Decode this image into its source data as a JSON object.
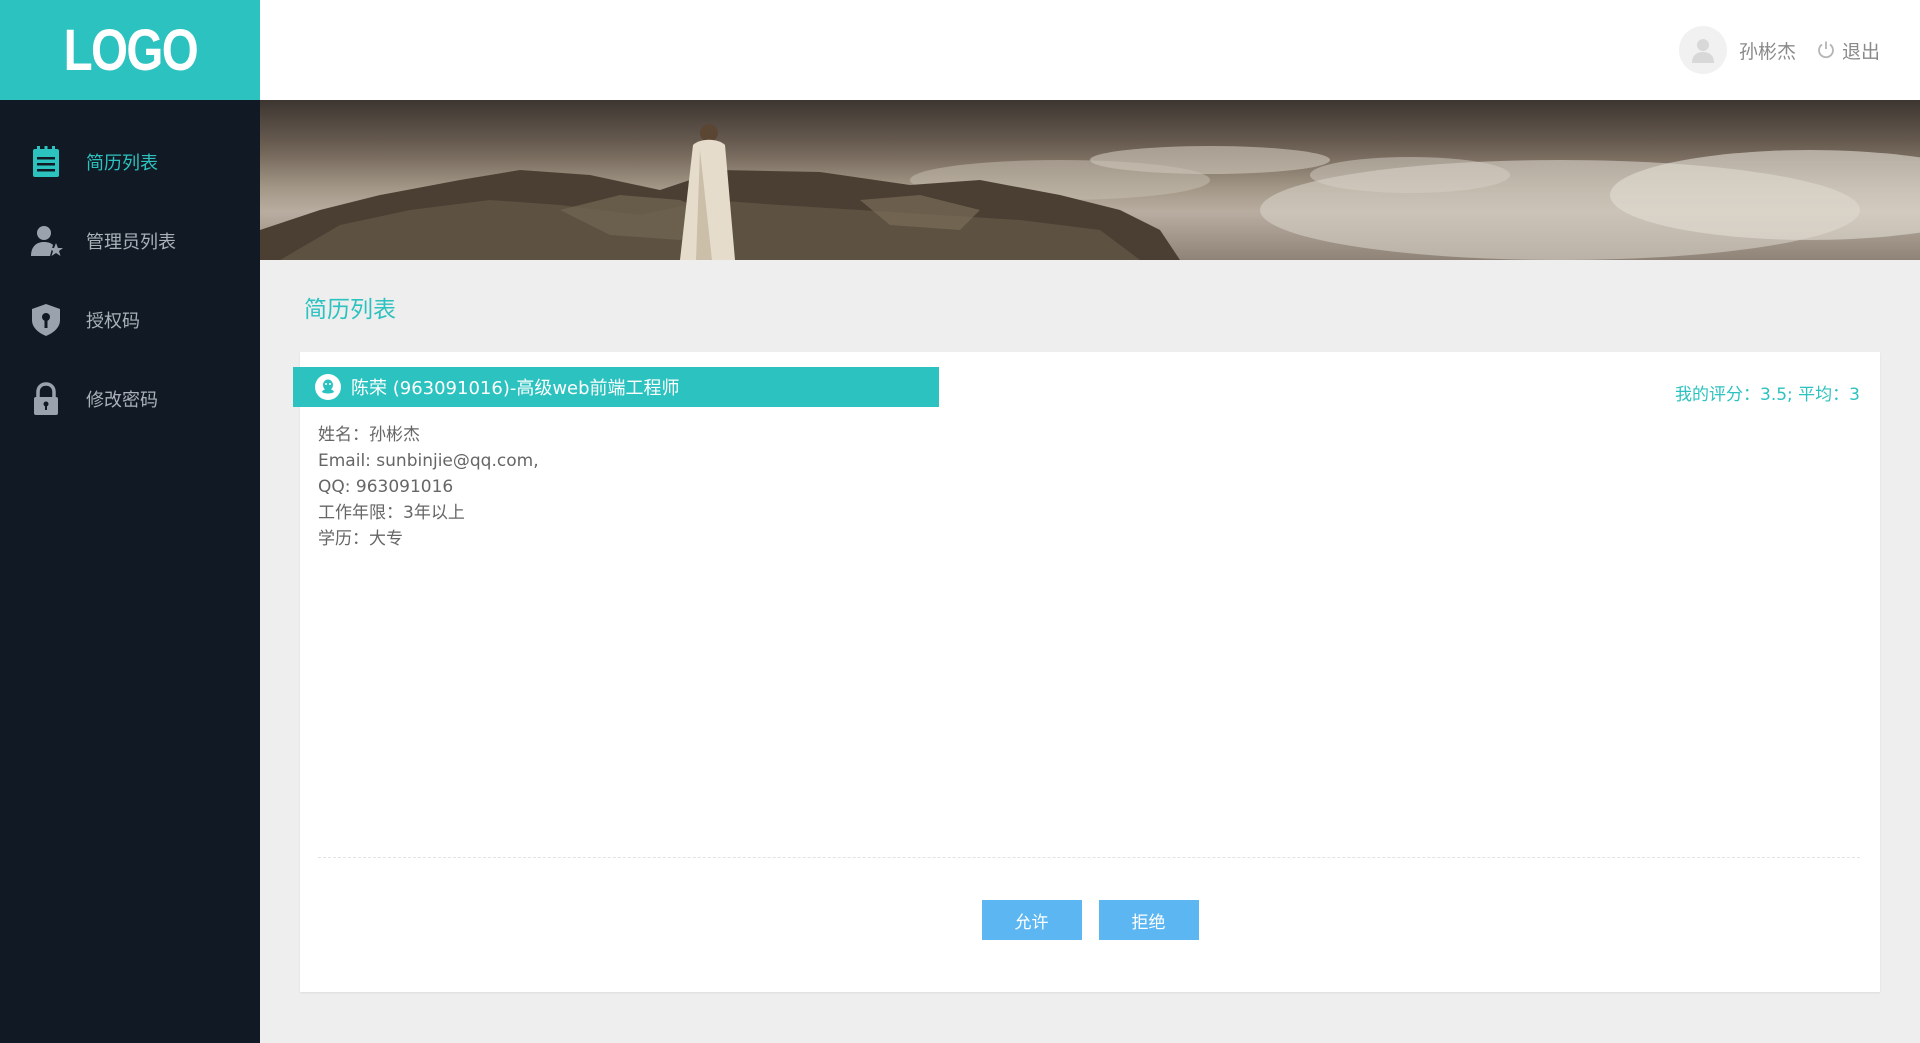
{
  "logo": {
    "text": "LOGO"
  },
  "sidebar": {
    "items": [
      {
        "label": "简历列表",
        "icon": "clipboard-list-icon",
        "active": true
      },
      {
        "label": "管理员列表",
        "icon": "user-star-icon",
        "active": false
      },
      {
        "label": "授权码",
        "icon": "shield-key-icon",
        "active": false
      },
      {
        "label": "修改密码",
        "icon": "lock-icon",
        "active": false
      }
    ]
  },
  "header": {
    "username": "孙彬杰",
    "logout_label": "退出"
  },
  "page": {
    "title": "简历列表"
  },
  "resume": {
    "title": "陈荣 (963091016)-高级web前端工程师",
    "rating": "我的评分：3.5; 平均：3",
    "info": [
      "姓名：孙彬杰",
      "Email: sunbinjie@qq.com,",
      "QQ: 963091016",
      "工作年限：3年以上",
      "学历：大专"
    ],
    "approve_label": "允许",
    "reject_label": "拒绝"
  },
  "colors": {
    "accent": "#2cc2c0",
    "sidebar_bg": "#111a24",
    "button": "#5cb6f2",
    "page_bg": "#eeeeee"
  }
}
